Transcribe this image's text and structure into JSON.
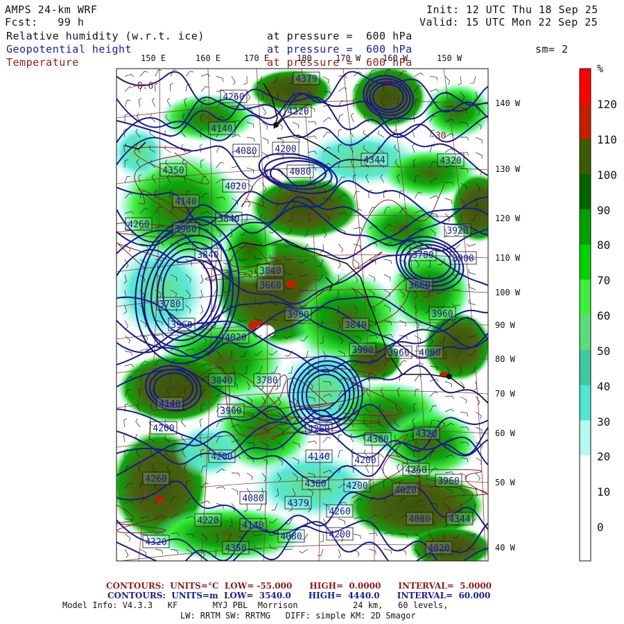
{
  "header": {
    "model": "AMPS 24-km WRF",
    "fcst": "Fcst:   99 h",
    "init": "Init: 12 UTC Thu 18 Sep 25",
    "valid": "Valid: 15 UTC Mon 22 Sep 25",
    "field1_name": "Relative humidity (w.r.t. ice)",
    "field1_level": "at pressure =  600 hPa",
    "field2_name": "Geopotential height",
    "field2_level": "at pressure =  600 hPa",
    "field3_name": "Temperature",
    "field3_level": "at pressure =  600 hPa",
    "smoothing": "sm= 2"
  },
  "longitude_labels": [
    "150 E",
    "160 E",
    "170 E",
    "180",
    "170 W",
    "160 W",
    "150 W"
  ],
  "latitude_labels": [
    "140 W",
    "130 W",
    "120 W",
    "110 W",
    "100 W",
    "90 W",
    "80 W",
    "70 W",
    "60 W",
    "50 W",
    "40 W"
  ],
  "colorbar": {
    "unit": "%",
    "labels": [
      "120",
      "110",
      "100",
      "90",
      "80",
      "70",
      "60",
      "50",
      "40",
      "30",
      "20",
      "10",
      "0"
    ],
    "colors": [
      "#ff0000",
      "#c81e00",
      "#3c5a00",
      "#006400",
      "#00a000",
      "#00d200",
      "#3cf03c",
      "#5adc78",
      "#3cc8a0",
      "#50e6d2",
      "#b4faf0",
      "#ffffff",
      "#ffffff",
      "#ffffff"
    ]
  },
  "height_contour_labels": [
    "4379",
    "4260",
    "4220",
    "4140",
    "4080",
    "4200",
    "4080",
    "4344",
    "4320",
    "4350",
    "4020",
    "4140",
    "4260",
    "3960",
    "3840",
    "3920",
    "3780",
    "3900",
    "3840",
    "3660",
    "3840",
    "3900",
    "3840",
    "3660",
    "3780",
    "3960",
    "4020",
    "3960",
    "3840",
    "3780",
    "3900",
    "3960",
    "4080",
    "3960",
    "4140",
    "4200",
    "4260",
    "4380",
    "4320",
    "4200",
    "4140",
    "4200",
    "4260",
    "4260",
    "4380",
    "4200",
    "4020",
    "3960",
    "4080"
  ],
  "temperature_labels": [
    "-8.6",
    "-25",
    "-30"
  ],
  "footer": {
    "temp_contours": "CONTOURS:  UNITS=°C  LOW= -55.000      HIGH=  0.0000      INTERVAL=  5.0000",
    "height_contours": "CONTOURS:  UNITS=m  LOW=  3540.0      HIGH=  4440.0      INTERVAL=  60.000",
    "model_info_1": "Model Info: V4.3.3   KF       MYJ PBL  Morrison           24 km,   60 levels,",
    "model_info_2": "LW: RRTM SW: RRTMG   DIFF: simple KM: 2D Smagor"
  },
  "colors": {
    "height_contour": "#1a1a8c",
    "temperature_contour": "#8b1a1a",
    "coastline": "#111111",
    "grid": "#8b3a3a"
  }
}
